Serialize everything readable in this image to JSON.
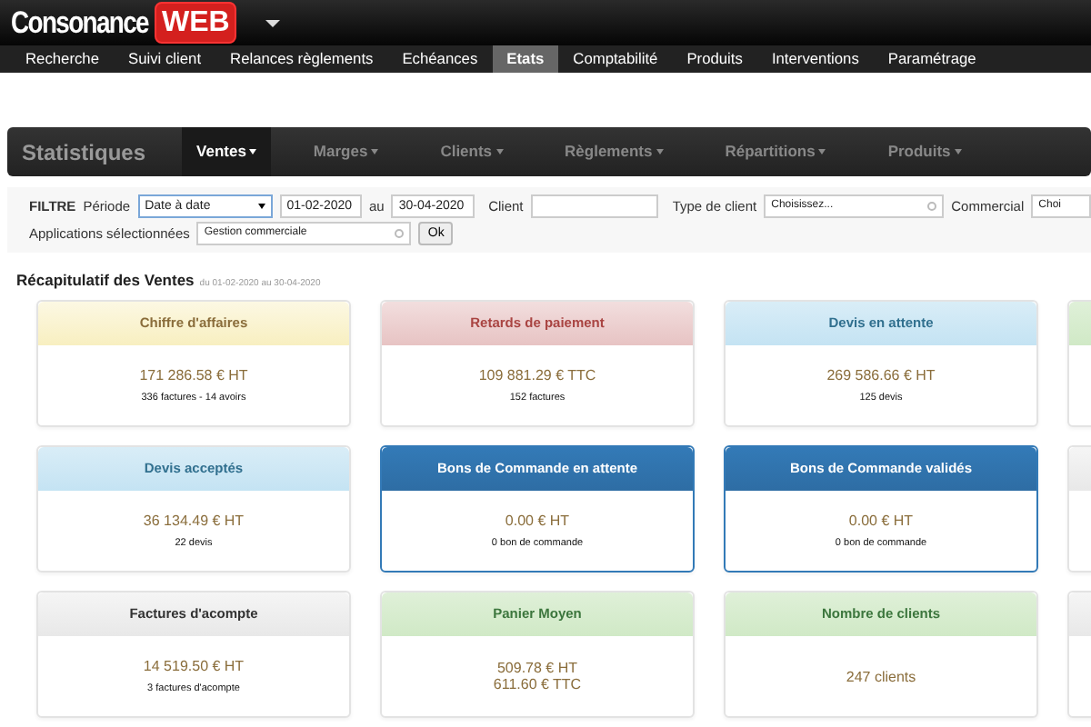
{
  "header": {
    "logo_text": "Consonance",
    "logo_badge": "WEB"
  },
  "menu": [
    {
      "label": "Recherche",
      "selected": false
    },
    {
      "label": "Suivi client",
      "selected": false
    },
    {
      "label": "Relances règlements",
      "selected": false
    },
    {
      "label": "Echéances",
      "selected": false
    },
    {
      "label": "Etats",
      "selected": true
    },
    {
      "label": "Comptabilité",
      "selected": false
    },
    {
      "label": "Produits",
      "selected": false
    },
    {
      "label": "Interventions",
      "selected": false
    },
    {
      "label": "Paramétrage",
      "selected": false
    }
  ],
  "stats_nav": {
    "title": "Statistiques",
    "tabs": [
      {
        "label": "Ventes",
        "selected": true
      },
      {
        "label": "Marges",
        "selected": false
      },
      {
        "label": "Clients",
        "selected": false
      },
      {
        "label": "Règlements",
        "selected": false
      },
      {
        "label": "Répartitions",
        "selected": false
      },
      {
        "label": "Produits",
        "selected": false
      }
    ]
  },
  "filter": {
    "title": "FILTRE",
    "period_label": "Période",
    "period_value": "Date à date",
    "date_from": "01-02-2020",
    "to_label": "au",
    "date_to": "30-04-2020",
    "client_label": "Client",
    "client_type_label": "Type de client",
    "client_type_value": "Choisissez...",
    "sales_label": "Commercial",
    "sales_value": "Choi",
    "apps_label": "Applications sélectionnées",
    "apps_value": "Gestion commerciale",
    "ok_button": "Ok"
  },
  "summary": {
    "title": "Récapitulatif des Ventes",
    "period": "du 01-02-2020 au 30-04-2020"
  },
  "cards": [
    {
      "kind": "warning",
      "title": "Chiffre d'affaires",
      "values": [
        "171 286.58 € HT"
      ],
      "note": "336 factures - 14 avoirs"
    },
    {
      "kind": "danger",
      "title": "Retards de paiement",
      "values": [
        "109 881.29 € TTC"
      ],
      "note": "152 factures"
    },
    {
      "kind": "info",
      "title": "Devis en attente",
      "values": [
        "269 586.66 € HT"
      ],
      "note": "125 devis"
    },
    {
      "kind": "info",
      "title": "Devis acceptés",
      "values": [
        "36 134.49 € HT"
      ],
      "note": "22 devis"
    },
    {
      "kind": "primary",
      "title": "Bons de Commande en attente",
      "values": [
        "0.00 € HT"
      ],
      "note": "0 bon de commande"
    },
    {
      "kind": "primary",
      "title": "Bons de Commande validés",
      "values": [
        "0.00 € HT"
      ],
      "note": "0 bon de commande"
    },
    {
      "kind": "default",
      "title": "Factures d'acompte",
      "values": [
        "14 519.50 € HT"
      ],
      "note": "3 factures d'acompte"
    },
    {
      "kind": "success",
      "title": "Panier Moyen",
      "values": [
        "509.78 € HT",
        "611.60 € TTC"
      ]
    },
    {
      "kind": "success",
      "title": "Nombre de clients",
      "values": [
        "247 clients"
      ]
    }
  ],
  "edge_cards": [
    {
      "kind": "success"
    },
    {
      "kind": "default"
    },
    {
      "kind": "default"
    }
  ]
}
